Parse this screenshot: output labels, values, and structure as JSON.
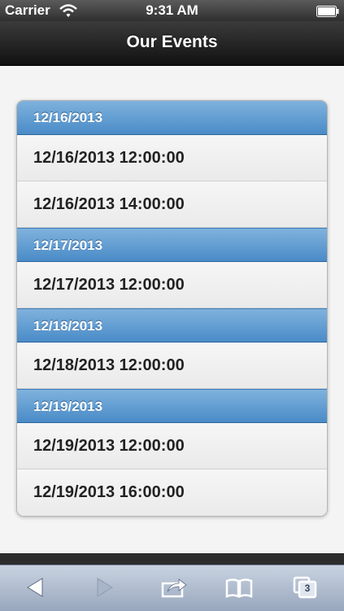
{
  "status_bar": {
    "carrier": "Carrier",
    "time": "9:31 AM"
  },
  "header": {
    "title": "Our Events"
  },
  "events": [
    {
      "date": "12/16/2013",
      "items": [
        "12/16/2013 12:00:00",
        "12/16/2013 14:00:00"
      ]
    },
    {
      "date": "12/17/2013",
      "items": [
        "12/17/2013 12:00:00"
      ]
    },
    {
      "date": "12/18/2013",
      "items": [
        "12/18/2013 12:00:00"
      ]
    },
    {
      "date": "12/19/2013",
      "items": [
        "12/19/2013 12:00:00",
        "12/19/2013 16:00:00"
      ]
    }
  ],
  "toolbar": {
    "icons": [
      "back-arrow-icon",
      "forward-arrow-icon",
      "share-icon",
      "bookmarks-book-icon",
      "tabs-icon"
    ],
    "tabs_count": "3"
  },
  "colors": {
    "divider": "#5b97cf",
    "header": "#1a1a1a",
    "toolbar": "#a9b6c9"
  }
}
